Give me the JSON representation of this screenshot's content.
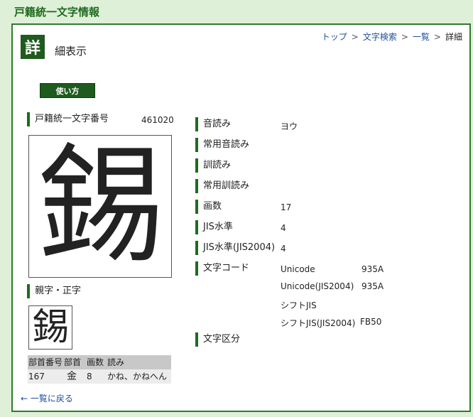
{
  "site_title": "戸籍統一文字情報",
  "detail_badge": "詳",
  "page_heading": "細表示",
  "breadcrumb": {
    "items": [
      "トップ",
      "文字検索",
      "一覧",
      "詳細"
    ],
    "separator": ">"
  },
  "usage_button": "使い方",
  "char_number": {
    "label": "戸籍統一文字番号",
    "value": "461020"
  },
  "main_char": "錫",
  "parent_char": {
    "label": "親字・正字",
    "char": "錫"
  },
  "radical_table": {
    "headers": [
      "部首番号",
      "部首",
      "画数",
      "読み"
    ],
    "row": {
      "number": "167",
      "radical": "金",
      "strokes": "8",
      "reading": "かね、かねへん"
    }
  },
  "details": {
    "on_reading": {
      "label": "音読み",
      "value": "ヨウ"
    },
    "joyo_on": {
      "label": "常用音読み",
      "value": ""
    },
    "kun_reading": {
      "label": "訓読み",
      "value": ""
    },
    "joyo_kun": {
      "label": "常用訓読み",
      "value": ""
    },
    "stroke_count": {
      "label": "画数",
      "value": "17"
    },
    "jis_level": {
      "label": "JIS水準",
      "value": "4"
    },
    "jis2004_level": {
      "label": "JIS水準(JIS2004)",
      "value": "4"
    },
    "char_code": {
      "label": "文字コード",
      "entries": [
        {
          "name": "Unicode",
          "value": "935A"
        },
        {
          "name": "Unicode(JIS2004)",
          "value": "935A"
        },
        {
          "name": "シフトJIS",
          "value": ""
        },
        {
          "name": "シフトJIS(JIS2004)",
          "value": "FB50"
        }
      ]
    },
    "char_class": {
      "label": "文字区分",
      "value": ""
    }
  },
  "back_link": "← 一覧に戻る",
  "colors": {
    "accent": "#1f6b1f",
    "link": "#1f4fa0",
    "background": "#dff0d8"
  }
}
